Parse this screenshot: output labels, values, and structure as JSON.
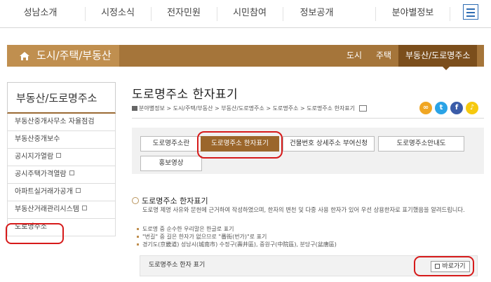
{
  "topnav": {
    "items": [
      "성남소개",
      "시정소식",
      "전자민원",
      "시민참여",
      "정보공개",
      "분야별정보"
    ]
  },
  "banner": {
    "title": "도시/주택/부동산",
    "subs": [
      "도시",
      "주택",
      "부동산/도로명주소"
    ]
  },
  "sidebar": {
    "heading": "부동산/도로명주소",
    "items": [
      "부동산중개사무소 자율점검",
      "부동산중개보수",
      "공시지가열람",
      "공시주택가격열람",
      "아파트실거래가공개",
      "부동산거래관리시스템",
      "도로명주소"
    ]
  },
  "main": {
    "title": "도로명주소 한자표기",
    "breadcrumb": "분야별정보 > 도시/주택/부동산 > 부동산/도로명주소 > 도로명주소 > 도로명주소 한자표기"
  },
  "tabs": [
    "도로명주소란",
    "도로명주소 한자표기",
    "건물번호 상세주소 부여신청",
    "도로명주소안내도",
    "홍보영상"
  ],
  "section": {
    "heading": "도로명주소 한자표기",
    "description": "도로명 제명 사유와 문헌에 근거하여 작성하였으며, 한자의 변천 및 다중 사용 한자가 있어 우선 상용한자로 표기했음을 알려드립니다.",
    "bullets": [
      "도로명 중 순수한 우리말은 한글로 표기",
      "\"번길\" 중 길은 한자가 없으므로 \"番街(번가)\"로 표기",
      "경기도(京畿道) 성남시(城南市) 수정구(壽井區), 중원구(中院區), 분당구(盆唐區)"
    ]
  },
  "linkbox": {
    "label": "도로명주소 한자 표기",
    "button": "바로가기"
  },
  "colors": {
    "brown": "#a5753a",
    "brown_light": "#c08f4f",
    "brown_dark": "#7b4e1c",
    "annotation_red": "#d61a1a"
  }
}
